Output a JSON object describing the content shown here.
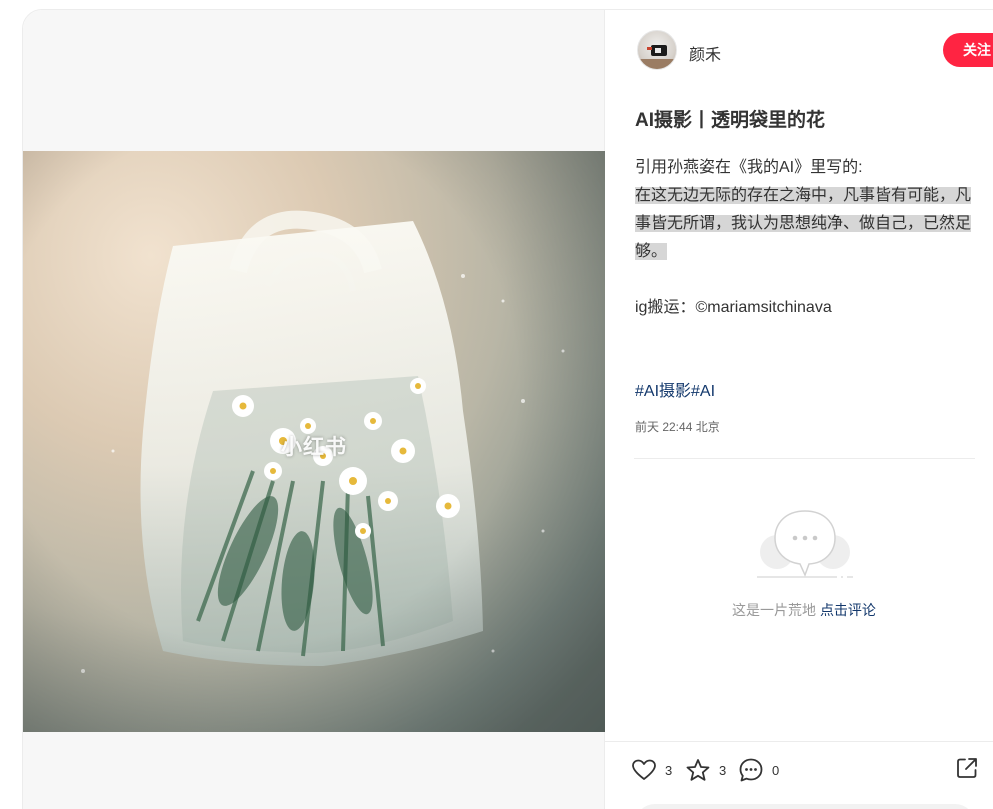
{
  "author": {
    "name": "颜禾",
    "follow_label": "关注"
  },
  "note": {
    "title": "AI摄影丨透明袋里的花",
    "intro": "引用孙燕姿在《我的AI》里写的:",
    "quote": "在这无边无际的存在之海中，凡事皆有可能，凡事皆无所谓，我认为思想纯净、做自己，已然足够。",
    "credit": "ig搬运：©mariamsitchinava",
    "tags": [
      "#AI摄影",
      "#AI"
    ],
    "date": "前天 22:44 北京"
  },
  "image": {
    "watermark": "小红书"
  },
  "comments": {
    "empty_text": "这是一片荒地",
    "comment_cta": "点击评论"
  },
  "engagement": {
    "likes": "3",
    "collects": "3",
    "comments": "0"
  },
  "colors": {
    "accent": "#ff2442",
    "link": "#13386c"
  }
}
